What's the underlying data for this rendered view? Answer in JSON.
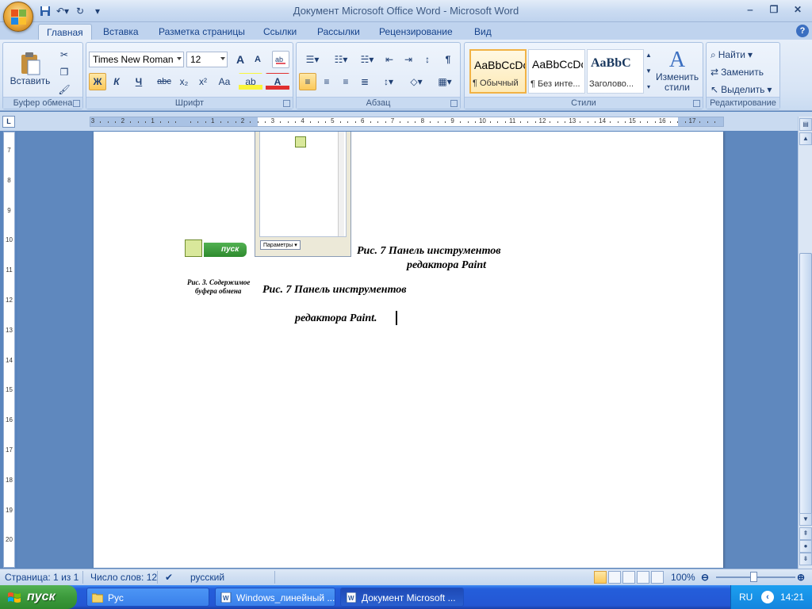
{
  "window": {
    "title": "Документ Microsoft Office Word - Microsoft Word",
    "controls": {
      "minimize": "‒",
      "restore": "❐",
      "close": "✕"
    }
  },
  "quick_access": [
    "save-icon",
    "undo-icon",
    "redo-icon",
    "customize-icon"
  ],
  "tabs": [
    "Главная",
    "Вставка",
    "Разметка страницы",
    "Ссылки",
    "Рассылки",
    "Рецензирование",
    "Вид"
  ],
  "active_tab": "Главная",
  "ribbon": {
    "clipboard": {
      "label": "Буфер обмена",
      "paste": "Вставить"
    },
    "font": {
      "label": "Шрифт",
      "font_name": "Times New Roman",
      "font_size": "12",
      "bold": "Ж",
      "italic": "К",
      "underline": "Ч",
      "strike": "abc",
      "subscript": "x₂",
      "superscript": "x²",
      "case": "Aa",
      "grow": "A",
      "shrink": "A",
      "highlight": "ab",
      "color": "A"
    },
    "paragraph": {
      "label": "Абзац",
      "pilcrow": "¶"
    },
    "styles": {
      "label": "Стили",
      "items": [
        {
          "sample": "AaBbCcDc",
          "name": "¶ Обычный"
        },
        {
          "sample": "AaBbCcDc",
          "name": "¶ Без инте..."
        },
        {
          "sample": "AaBbC",
          "name": "Заголово..."
        }
      ],
      "change_styles": "Изменить стили"
    },
    "editing": {
      "label": "Редактирование",
      "find": "Найти",
      "replace": "Заменить",
      "select": "Выделить"
    }
  },
  "ruler": {
    "h_labels": [
      "3",
      "2",
      "1",
      "",
      "1",
      "2",
      "3",
      "4",
      "5",
      "6",
      "7",
      "8",
      "9",
      "10",
      "11",
      "12",
      "13",
      "14",
      "15",
      "16",
      "17"
    ],
    "v_labels": [
      "7",
      "8",
      "9",
      "10",
      "11",
      "12",
      "13",
      "14",
      "15",
      "16",
      "17",
      "18",
      "19",
      "20"
    ]
  },
  "document": {
    "embedded_start_label": "пуск",
    "embedded_params_label": "Параметры",
    "caption_fig3_line1": "Рис. 3.  Содержимое",
    "caption_fig3_line2": "буфера обмена",
    "caption_top_line1": "Рис. 7  Панель инструментов",
    "caption_top_line2": "редактора Paint",
    "caption_main_line1": "Рис. 7 Панель инструментов",
    "caption_main_line2": "редактора Paint."
  },
  "status": {
    "page": "Страница: 1 из 1",
    "words": "Число слов: 12",
    "language": "русский",
    "zoom": "100%"
  },
  "taskbar": {
    "start": "пуск",
    "tasks": [
      "Рус",
      "Windows_линейный ...",
      "Документ Microsoft ..."
    ],
    "active_task": 2,
    "lang": "RU",
    "time": "14:21"
  }
}
